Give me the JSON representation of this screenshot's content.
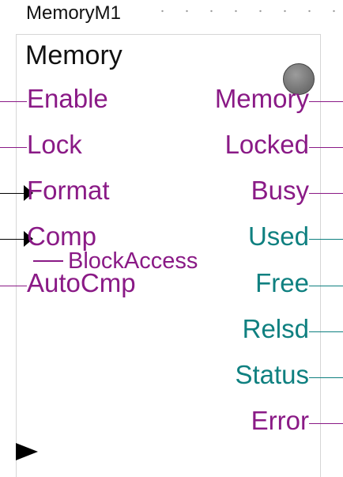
{
  "instance_name": "MemoryM1",
  "block": {
    "title": "Memory",
    "status_led": {
      "state": "off",
      "color": "#7a7a7a"
    }
  },
  "inputs": [
    {
      "label": "Enable",
      "color": "#8a1a86",
      "marker": "line"
    },
    {
      "label": "Lock",
      "color": "#8a1a86",
      "marker": "line"
    },
    {
      "label": "Format",
      "color": "#8a1a86",
      "marker": "edge-triangle"
    },
    {
      "label": "Comp",
      "color": "#8a1a86",
      "marker": "edge-triangle"
    },
    {
      "label": "AutoCmp",
      "color": "#8a1a86",
      "marker": "line"
    }
  ],
  "outputs": [
    {
      "label": "Memory",
      "color": "#8a1a86"
    },
    {
      "label": "Locked",
      "color": "#8a1a86"
    },
    {
      "label": "Busy",
      "color": "#8a1a86"
    },
    {
      "label": "Used",
      "color": "#0f8080"
    },
    {
      "label": "Free",
      "color": "#0f8080"
    },
    {
      "label": "Relsd",
      "color": "#0f8080"
    },
    {
      "label": "Status",
      "color": "#0f8080"
    },
    {
      "label": "Error",
      "color": "#8a1a86"
    }
  ],
  "annotation": {
    "text": "BlockAccess",
    "color": "#8a1a86"
  }
}
